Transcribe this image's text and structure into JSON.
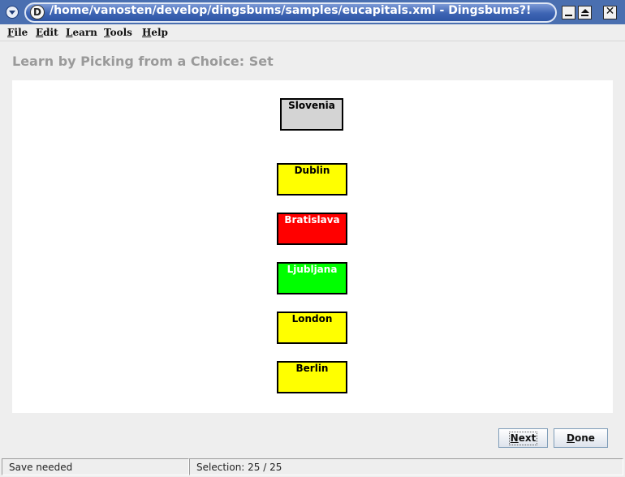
{
  "window": {
    "title": "/home/vanosten/develop/dingsbums/samples/eucapitals.xml - Dingsbums?!",
    "app_icon_glyph": "D",
    "close_glyph": "✕"
  },
  "menu": [
    {
      "mnemonic": "F",
      "rest": "ile"
    },
    {
      "mnemonic": "E",
      "rest": "dit"
    },
    {
      "mnemonic": "L",
      "rest": "earn"
    },
    {
      "mnemonic": "T",
      "rest": "ools"
    },
    {
      "mnemonic": "H",
      "rest": "elp"
    }
  ],
  "page_title": "Learn by Picking from a Choice: Set",
  "question": {
    "label": "Slovenia",
    "color": "#d4d4d4"
  },
  "choices": [
    {
      "label": "Dublin",
      "color": "#ffff00",
      "text_color": "#000000"
    },
    {
      "label": "Bratislava",
      "color": "#ff0000",
      "text_color": "#ffffff"
    },
    {
      "label": "Ljubljana",
      "color": "#00ff00",
      "text_color": "#ffffff"
    },
    {
      "label": "London",
      "color": "#ffff00",
      "text_color": "#000000"
    },
    {
      "label": "Berlin",
      "color": "#ffff00",
      "text_color": "#000000"
    }
  ],
  "buttons": {
    "next": {
      "mnemonic": "N",
      "rest": "ext"
    },
    "done": {
      "mnemonic": "D",
      "rest": "one"
    }
  },
  "status": {
    "save": "Save needed",
    "selection": "Selection:  25 / 25"
  }
}
